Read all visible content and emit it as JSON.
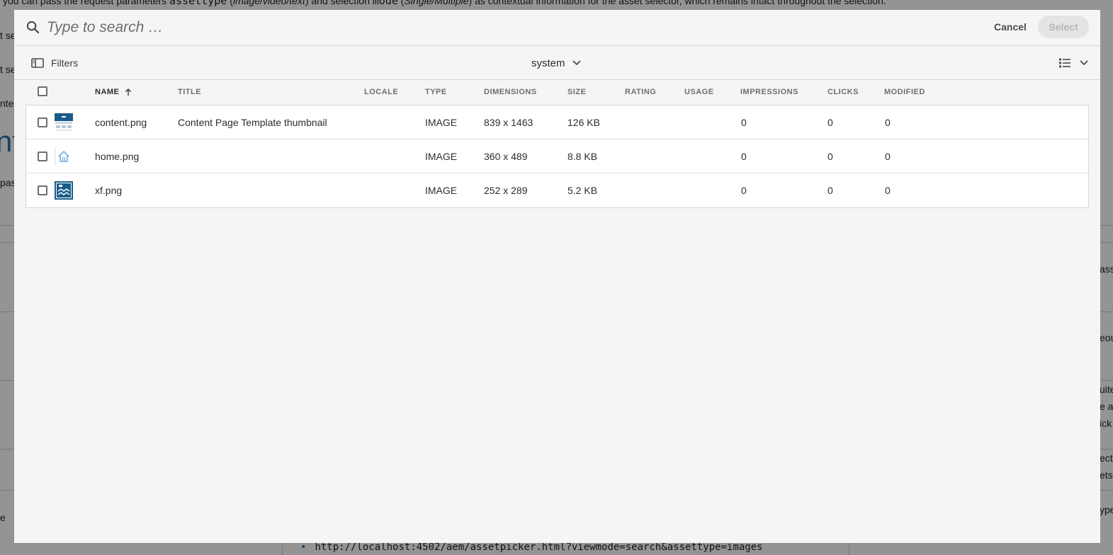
{
  "background": {
    "intro_prefix": "you can pass the request parameters ",
    "intro_code_1": "assettype",
    "intro_mid_1": " (",
    "intro_italic_1": "image/video/text",
    "intro_mid_2": ") and selection ",
    "intro_code_2": "mode",
    "intro_mid_3": " (",
    "intro_italic_2": "Single/Multiple",
    "intro_suffix": ") as contextual information for the asset selector, which remains intact throughout the selection.",
    "frag_left_1": "t se",
    "frag_left_2": "t se",
    "frag_left_3": "nteg",
    "frag_left_4": "pass",
    "frag_left_5": "e",
    "heading_fragment": "nt",
    "frag_right_1": "ass",
    "frag_right_2": "eou",
    "frag_right_3": "uite",
    "frag_right_4": "e a",
    "frag_right_5": "ick",
    "frag_right_6": "ect",
    "frag_right_7": "ets",
    "frag_right_8": "ype",
    "url_bullet": "•",
    "url": "http://localhost:4502/aem/assetpicker.html?viewmode=search&assettype=images"
  },
  "search": {
    "placeholder": "Type to search …",
    "value": ""
  },
  "actions": {
    "cancel_label": "Cancel",
    "select_label": "Select"
  },
  "toolbar": {
    "filters_label": "Filters",
    "path_label": "system",
    "icons": {
      "filters": "sidebar-panel-icon",
      "path": "chevron-down-icon",
      "view": "list-view-icon"
    }
  },
  "table": {
    "columns": [
      "NAME",
      "TITLE",
      "LOCALE",
      "TYPE",
      "DIMENSIONS",
      "SIZE",
      "RATING",
      "USAGE",
      "IMPRESSIONS",
      "CLICKS",
      "MODIFIED"
    ],
    "sorted_column": "NAME",
    "sort_direction": "ascending",
    "rows": [
      {
        "name": "content.png",
        "title": "Content Page Template thumbnail",
        "locale": "",
        "type": "IMAGE",
        "dimensions": "839 x 1463",
        "size": "126 KB",
        "rating": "",
        "usage": "",
        "impressions": "0",
        "clicks": "0",
        "modified": "0",
        "thumb": "content-page-thumbnail"
      },
      {
        "name": "home.png",
        "title": "",
        "locale": "",
        "type": "IMAGE",
        "dimensions": "360 x 489",
        "size": "8.8 KB",
        "rating": "",
        "usage": "",
        "impressions": "0",
        "clicks": "0",
        "modified": "0",
        "thumb": "home-thumbnail"
      },
      {
        "name": "xf.png",
        "title": "",
        "locale": "",
        "type": "IMAGE",
        "dimensions": "252 x 289",
        "size": "5.2 KB",
        "rating": "",
        "usage": "",
        "impressions": "0",
        "clicks": "0",
        "modified": "0",
        "thumb": "xf-thumbnail"
      }
    ]
  },
  "colors": {
    "accent_blue": "#1a5c8a",
    "dialog_bg": "#f5f5f5",
    "select_disabled_bg": "#e4e4e4"
  }
}
